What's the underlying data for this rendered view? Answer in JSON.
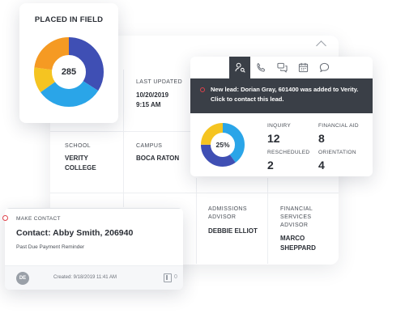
{
  "placed_in_field": {
    "title": "PLACED IN FIELD",
    "count": "285",
    "segments": [
      {
        "name": "navy",
        "fraction": 0.34,
        "color": "#3f4fb4"
      },
      {
        "name": "sky",
        "fraction": 0.31,
        "color": "#2aa5e8"
      },
      {
        "name": "yellow",
        "fraction": 0.12,
        "color": "#f5c421"
      },
      {
        "name": "orange",
        "fraction": 0.23,
        "color": "#f59a23"
      }
    ]
  },
  "student_details": {
    "last_updated": {
      "label": "LAST UPDATED",
      "date": "10/20/2019",
      "time": "9:15 AM"
    },
    "school": {
      "label": "SCHOOL",
      "value_line1": "VERITY",
      "value_line2": "COLLEGE"
    },
    "campus": {
      "label": "CAMPUS",
      "value": "BOCA RATON"
    },
    "admissions_advisor": {
      "label_line1": "ADMISSIONS",
      "label_line2": "ADVISOR",
      "value": "DEBBIE ELLIOT"
    },
    "financial_services_advisor": {
      "label_line1": "FINANCIAL",
      "label_line2": "SERVICES",
      "label_line3": "ADVISOR",
      "value_line1": "MARCO",
      "value_line2": "SHEPPARD"
    }
  },
  "lead_card": {
    "toolbar_icons": [
      "user-search-icon",
      "phone-icon",
      "chat-icon",
      "calendar-icon",
      "message-icon"
    ],
    "banner_text": "New lead: Dorian Gray, 601400 was added to Verity. Click to contact this lead.",
    "percent_label": "25%",
    "donut_segments": [
      {
        "name": "sky",
        "fraction": 0.4,
        "color": "#2aa5e8"
      },
      {
        "name": "navy",
        "fraction": 0.35,
        "color": "#3f4fb4"
      },
      {
        "name": "yellow",
        "fraction": 0.25,
        "color": "#f5c421"
      }
    ],
    "stats": {
      "inquiry": {
        "label": "INQUIRY",
        "value": "12"
      },
      "financial_aid": {
        "label": "FINANCIAL AID",
        "value": "8"
      },
      "rescheduled": {
        "label": "RESCHEDULED",
        "value": "2"
      },
      "orientation": {
        "label": "ORIENTATION",
        "value": "4"
      }
    }
  },
  "contact_card": {
    "label": "MAKE CONTACT",
    "title": "Contact: Abby Smith, 206940",
    "subtitle": "Past Due Payment Reminder",
    "avatar_initials": "DE",
    "created": "Created: 9/18/2019 11:41 AM",
    "attachment_count": "0"
  },
  "colors": {
    "dark_banner": "#3a3f47",
    "alert_red": "#e0424b",
    "text_dark": "#2a2e35"
  }
}
